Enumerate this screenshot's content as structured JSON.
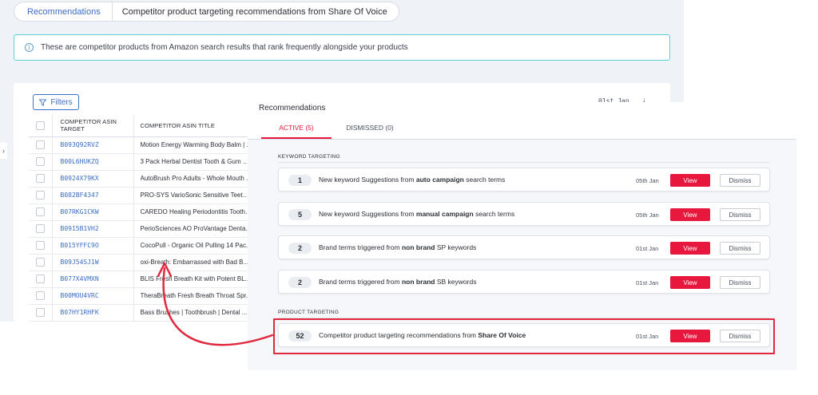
{
  "breadcrumb": {
    "root": "Recommendations",
    "current": "Competitor product targeting recommendations from Share Of Voice"
  },
  "info_banner": {
    "icon": "info-icon",
    "text": "These are competitor products from Amazon search results that rank frequently alongside your products"
  },
  "table_card": {
    "filters_label": "Filters",
    "date_label": "01st Jan",
    "sort_glyph": "↓",
    "columns": {
      "asin": "COMPETITOR ASIN TARGET",
      "title": "COMPETITOR ASIN TITLE"
    },
    "rows": [
      {
        "asin": "B093Q92RVZ",
        "title": "Motion Energy Warming Body Balm | ..."
      },
      {
        "asin": "B00L6HUKZQ",
        "title": "3 Pack Herbal Dentist Tooth & Gum O..."
      },
      {
        "asin": "B0924X79KX",
        "title": "AutoBrush Pro Adults - Whole Mouth ..."
      },
      {
        "asin": "B082BF4347",
        "title": "PRO-SYS VarioSonic Sensitive Teeth a..."
      },
      {
        "asin": "B07RKG1CKW",
        "title": "CAREDO Healing Periodontitis Toothp..."
      },
      {
        "asin": "B0915B1VH2",
        "title": "PerioSciences AO ProVantage Dental ..."
      },
      {
        "asin": "B015YFFC9O",
        "title": "CocoPull - Organic Oil Pulling 14 Pac..."
      },
      {
        "asin": "B09J54SJ1W",
        "title": "oxi-Breath: Embarrassed with Bad B..."
      },
      {
        "asin": "B077X4VMXN",
        "title": "BLIS Fresh Breath Kit with Potent BL..."
      },
      {
        "asin": "B00MOU4VRC",
        "title": "TheraBreath Fresh Breath Throat Spr..."
      },
      {
        "asin": "B07HY1RHFK",
        "title": "Bass Brushes | Toothbrush | Dental ..."
      }
    ]
  },
  "modal": {
    "title": "Recommendations",
    "tabs": [
      {
        "label": "ACTIVE (5)",
        "active": true
      },
      {
        "label": "DISMISSED (0)",
        "active": false
      }
    ],
    "sections": {
      "keyword": "KEYWORD TARGETING",
      "product": "PRODUCT TARGETING"
    },
    "recommendations": [
      {
        "count": "1",
        "text_before": "New keyword Suggestions from ",
        "bold": "auto campaign",
        "text_after": " search terms",
        "date": "05th Jan",
        "view": "View",
        "dismiss": "Dismiss"
      },
      {
        "count": "5",
        "text_before": "New keyword Suggestions from ",
        "bold": "manual campaign",
        "text_after": " search terms",
        "date": "05th Jan",
        "view": "View",
        "dismiss": "Dismiss"
      },
      {
        "count": "2",
        "text_before": "Brand terms triggered from ",
        "bold": "non brand",
        "text_after": " SP keywords",
        "date": "01st Jan",
        "view": "View",
        "dismiss": "Dismiss"
      },
      {
        "count": "2",
        "text_before": "Brand terms triggered from ",
        "bold": "non brand",
        "text_after": " SB keywords",
        "date": "01st Jan",
        "view": "View",
        "dismiss": "Dismiss"
      },
      {
        "count": "52",
        "text_before": "Competitor product targeting recommendations from ",
        "bold": "Share Of Voice",
        "text_after": "",
        "date": "01st Jan",
        "view": "View",
        "dismiss": "Dismiss"
      }
    ]
  },
  "colors": {
    "accent_red": "#e8173d",
    "link_blue": "#3b6ec4",
    "banner_border": "#5fd0d6",
    "annotation_red": "#e0283f"
  }
}
